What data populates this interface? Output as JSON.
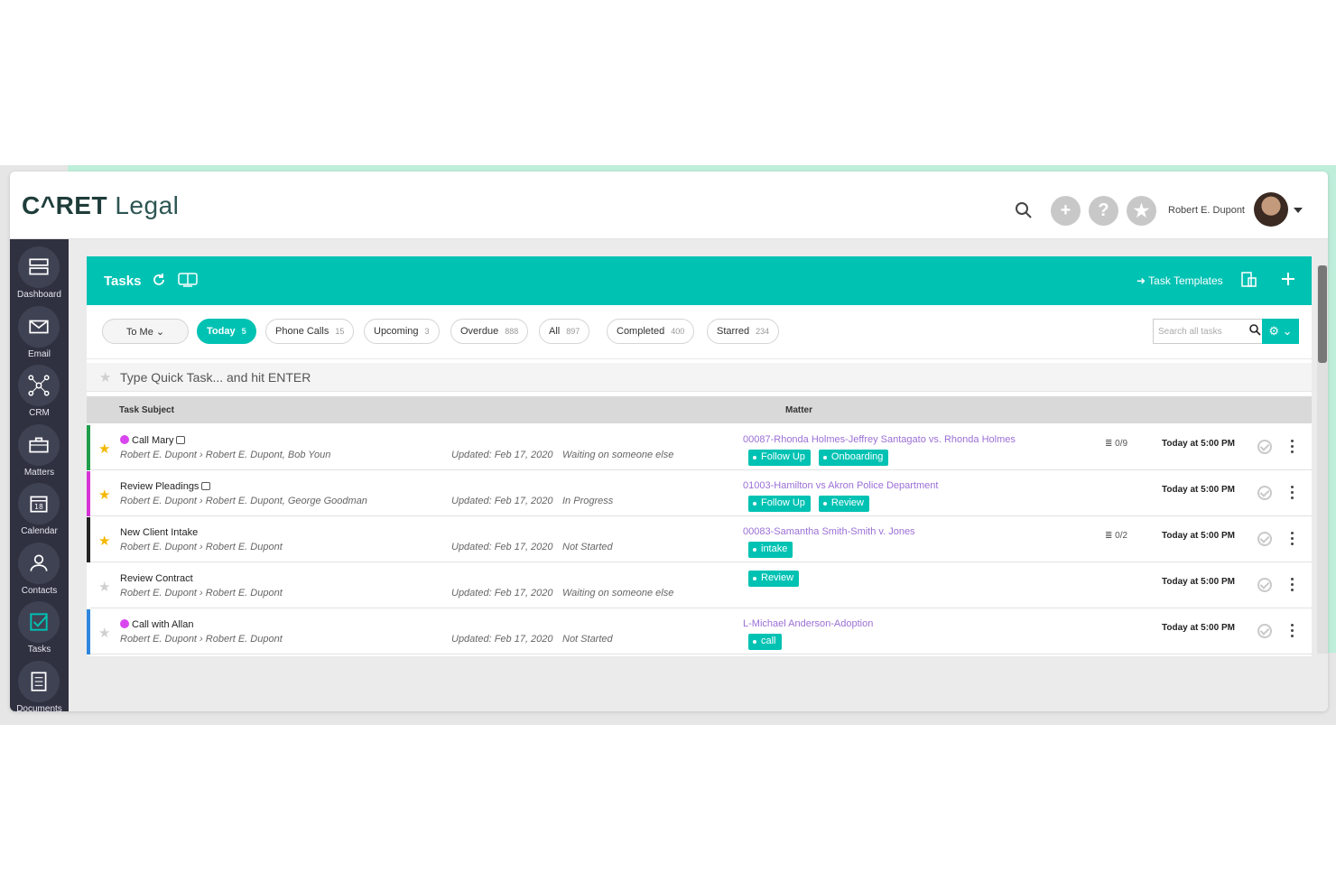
{
  "app": {
    "logo_caret": "C^RET",
    "logo_legal": " Legal",
    "user_name": "Robert E. Dupont"
  },
  "topbar_buttons": [
    {
      "name": "add-button",
      "glyph": "+"
    },
    {
      "name": "help-button",
      "glyph": "?"
    },
    {
      "name": "favorites-button",
      "glyph": "★"
    }
  ],
  "sidebar": {
    "items": [
      {
        "label": "Dashboard",
        "icon": "dashboard-icon"
      },
      {
        "label": "Email",
        "icon": "envelope-icon"
      },
      {
        "label": "CRM",
        "icon": "network-icon"
      },
      {
        "label": "Matters",
        "icon": "briefcase-icon"
      },
      {
        "label": "Calendar",
        "icon": "calendar-icon",
        "day": "18"
      },
      {
        "label": "Contacts",
        "icon": "contacts-icon"
      },
      {
        "label": "Tasks",
        "icon": "checkbox-icon"
      },
      {
        "label": "Documents",
        "icon": "document-icon"
      }
    ]
  },
  "panel": {
    "title": "Tasks",
    "templates_label": "➜ Task Templates"
  },
  "filters": {
    "to_me": "To Me ⌄",
    "pills": [
      {
        "label": "Today",
        "count": "5",
        "active": true
      },
      {
        "label": "Phone Calls",
        "count": "15"
      },
      {
        "label": "Upcoming",
        "count": "3"
      },
      {
        "label": "Overdue",
        "count": "888"
      },
      {
        "label": "All",
        "count": "897"
      },
      {
        "label": "Completed",
        "count": "400"
      },
      {
        "label": "Starred",
        "count": "234"
      }
    ],
    "search_placeholder": "Search all tasks"
  },
  "quick_task": {
    "placeholder": "Type Quick Task... and hit ENTER"
  },
  "table": {
    "headers": {
      "subject": "Task Subject",
      "matter": "Matter"
    },
    "rows": [
      {
        "subject": "Call Mary",
        "phone": true,
        "note": true,
        "starred": true,
        "bar_color": "#1f9d4a",
        "assign": "Robert E. Dupont  ›  Robert E. Dupont, Bob Youn",
        "updated": "Updated: Feb 17, 2020",
        "status": "Waiting on someone else",
        "matter": "00087-Rhonda Holmes-Jeffrey Santagato vs. Rhonda Holmes",
        "tags": [
          "Follow Up",
          "Onboarding"
        ],
        "checklist": "0/9",
        "due": "Today at 5:00 PM"
      },
      {
        "subject": "Review Pleadings",
        "phone": false,
        "note": true,
        "starred": true,
        "bar_color": "#d633d6",
        "assign": "Robert E. Dupont  ›  Robert E. Dupont, George Goodman",
        "updated": "Updated: Feb 17, 2020",
        "status": "In Progress",
        "matter": "01003-Hamilton vs Akron Police Department",
        "tags": [
          "Follow Up",
          "Review"
        ],
        "checklist": "",
        "due": "Today at 5:00 PM"
      },
      {
        "subject": "New Client Intake",
        "phone": false,
        "note": false,
        "starred": true,
        "bar_color": "#222222",
        "assign": "Robert E. Dupont  ›  Robert E. Dupont",
        "updated": "Updated: Feb 17, 2020",
        "status": "Not Started",
        "matter": "00083-Samantha Smith-Smith v. Jones",
        "tags": [
          "intake"
        ],
        "checklist": "0/2",
        "due": "Today at 5:00 PM"
      },
      {
        "subject": "Review Contract",
        "phone": false,
        "note": false,
        "starred": false,
        "bar_color": "#ffffff",
        "assign": "Robert E. Dupont  ›  Robert E. Dupont",
        "updated": "Updated: Feb 17, 2020",
        "status": "Waiting on someone else",
        "matter": "",
        "tags": [
          "Review"
        ],
        "checklist": "",
        "due": "Today at 5:00 PM"
      },
      {
        "subject": "Call with Allan",
        "phone": true,
        "note": false,
        "starred": false,
        "bar_color": "#2e86de",
        "assign": "Robert E. Dupont  ›  Robert E. Dupont",
        "updated": "Updated: Feb 17, 2020",
        "status": "Not Started",
        "matter": "L-Michael Anderson-Adoption",
        "tags": [
          "call"
        ],
        "checklist": "",
        "due": "Today at 5:00 PM"
      }
    ]
  },
  "colors": {
    "accent": "#00c2b3",
    "sidebar": "#2f3140",
    "matter_link": "#9b6fd6",
    "star_active": "#f5b800"
  }
}
